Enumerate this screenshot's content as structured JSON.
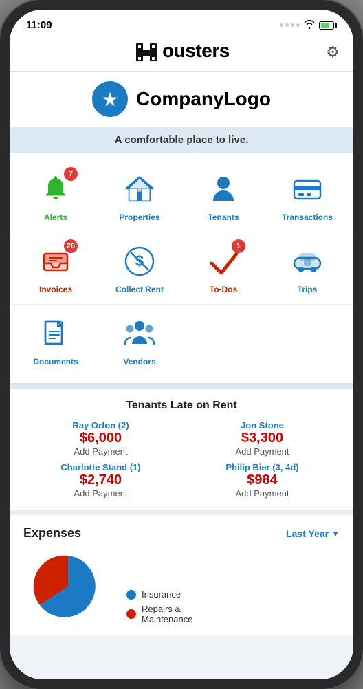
{
  "status": {
    "time": "11:09"
  },
  "header": {
    "logo_text": "ousters",
    "logo_h": "H",
    "settings_icon": "⚙",
    "settings_label": "Settings"
  },
  "company": {
    "name": "CompanyLogo",
    "tagline": "A comfortable place to live."
  },
  "menu_row1": [
    {
      "id": "alerts",
      "label": "Alerts",
      "color": "#2db52d",
      "badge": "7",
      "icon": "bell"
    },
    {
      "id": "properties",
      "label": "Properties",
      "color": "#1a7bc4",
      "badge": null,
      "icon": "home"
    },
    {
      "id": "tenants",
      "label": "Tenants",
      "color": "#1a7bc4",
      "badge": null,
      "icon": "person"
    },
    {
      "id": "transactions",
      "label": "Transactions",
      "color": "#1a7bc4",
      "badge": null,
      "icon": "card"
    }
  ],
  "menu_row2": [
    {
      "id": "invoices",
      "label": "Invoices",
      "color": "#cc2200",
      "badge": "26",
      "icon": "invoice"
    },
    {
      "id": "collect_rent",
      "label": "Collect Rent",
      "color": "#1a7bc4",
      "badge": null,
      "icon": "dollar"
    },
    {
      "id": "todos",
      "label": "To-Dos",
      "color": "#cc2200",
      "badge": "1",
      "icon": "check"
    },
    {
      "id": "trips",
      "label": "Trips",
      "color": "#1a7bc4",
      "badge": null,
      "icon": "car"
    }
  ],
  "menu_row3": [
    {
      "id": "documents",
      "label": "Documents",
      "color": "#1a7bc4",
      "badge": null,
      "icon": "doc"
    },
    {
      "id": "vendors",
      "label": "Vendors",
      "color": "#1a7bc4",
      "badge": null,
      "icon": "team"
    }
  ],
  "late_rent": {
    "title": "Tenants Late on Rent",
    "tenants": [
      {
        "name": "Ray Orfon (2)",
        "amount": "$6,000",
        "action": "Add Payment"
      },
      {
        "name": "Jon Stone",
        "amount": "$3,300",
        "action": "Add Payment"
      },
      {
        "name": "Charlotte Stand (1)",
        "amount": "$2,740",
        "action": "Add Payment"
      },
      {
        "name": "Philip Bier (3, 4d)",
        "amount": "$984",
        "action": "Add Payment"
      }
    ]
  },
  "expenses": {
    "title": "Expenses",
    "filter_label": "Last Year",
    "chart_legend": [
      {
        "label": "Insurance",
        "color": "#1a7bc4"
      },
      {
        "label": "Repairs &\nMaintenance",
        "color": "#cc2200"
      }
    ]
  }
}
